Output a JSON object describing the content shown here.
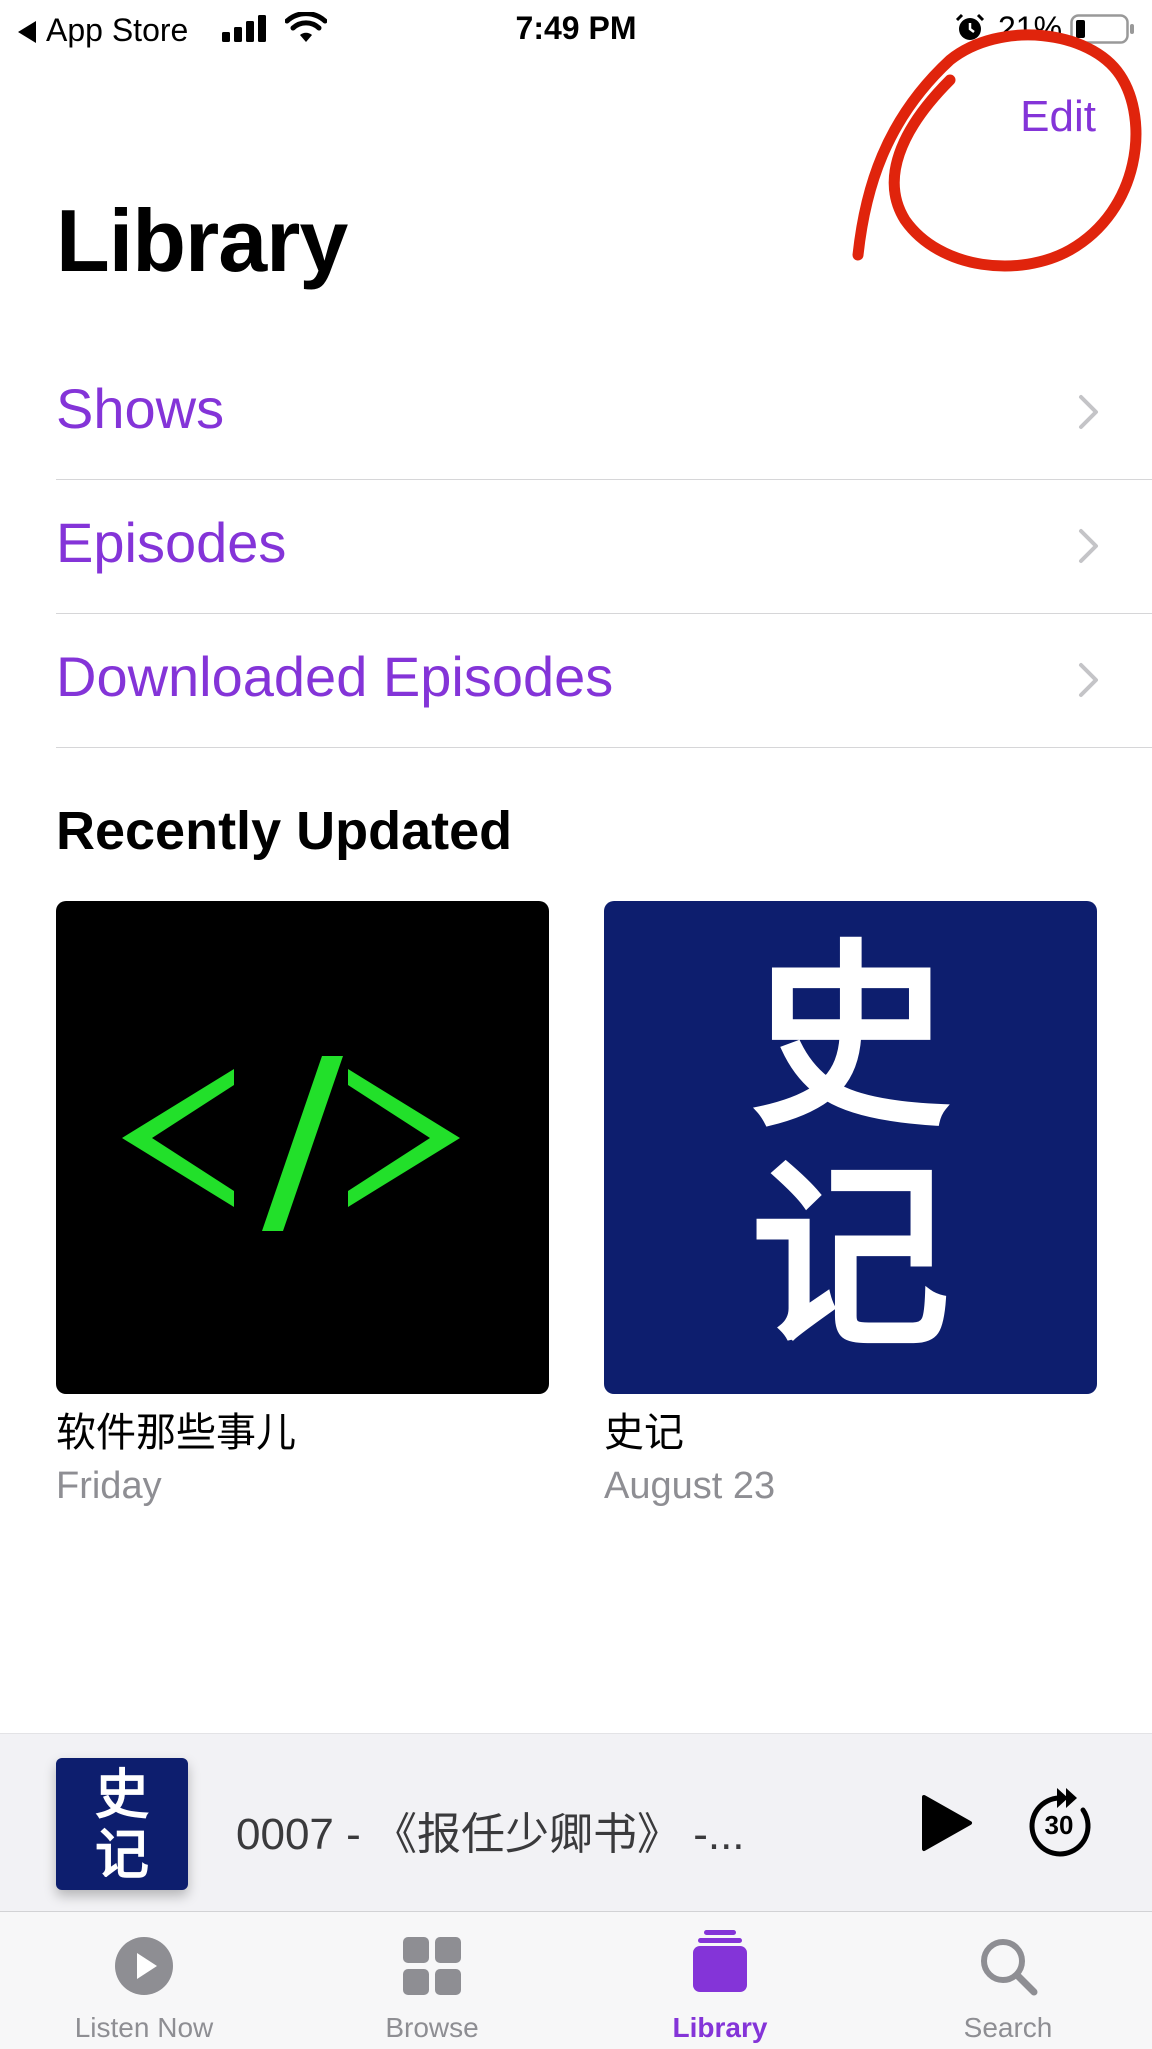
{
  "status_bar": {
    "back_app": "App Store",
    "time": "7:49 PM",
    "battery": "21%"
  },
  "nav": {
    "edit_label": "Edit"
  },
  "page_title": "Library",
  "library_rows": [
    {
      "label": "Shows"
    },
    {
      "label": "Episodes"
    },
    {
      "label": "Downloaded Episodes"
    }
  ],
  "recently_updated": {
    "title": "Recently Updated",
    "items": [
      {
        "name": "软件那些事儿",
        "date": "Friday",
        "art_text": "</>"
      },
      {
        "name": "史记",
        "date": "August 23",
        "art_chars": [
          "史",
          "记"
        ]
      }
    ]
  },
  "mini_player": {
    "title": "0007 - 《报任少卿书》 -...",
    "art_chars": [
      "史",
      "记"
    ],
    "skip_seconds": "30"
  },
  "tabs": [
    {
      "label": "Listen Now",
      "icon": "play-circle-icon"
    },
    {
      "label": "Browse",
      "icon": "grid-icon"
    },
    {
      "label": "Library",
      "icon": "stack-icon",
      "active": true
    },
    {
      "label": "Search",
      "icon": "search-icon"
    }
  ],
  "colors": {
    "accent": "#8434d8",
    "annotation": "#e0240c",
    "shiji_blue": "#0d1e6e",
    "code_green": "#22e02a"
  }
}
